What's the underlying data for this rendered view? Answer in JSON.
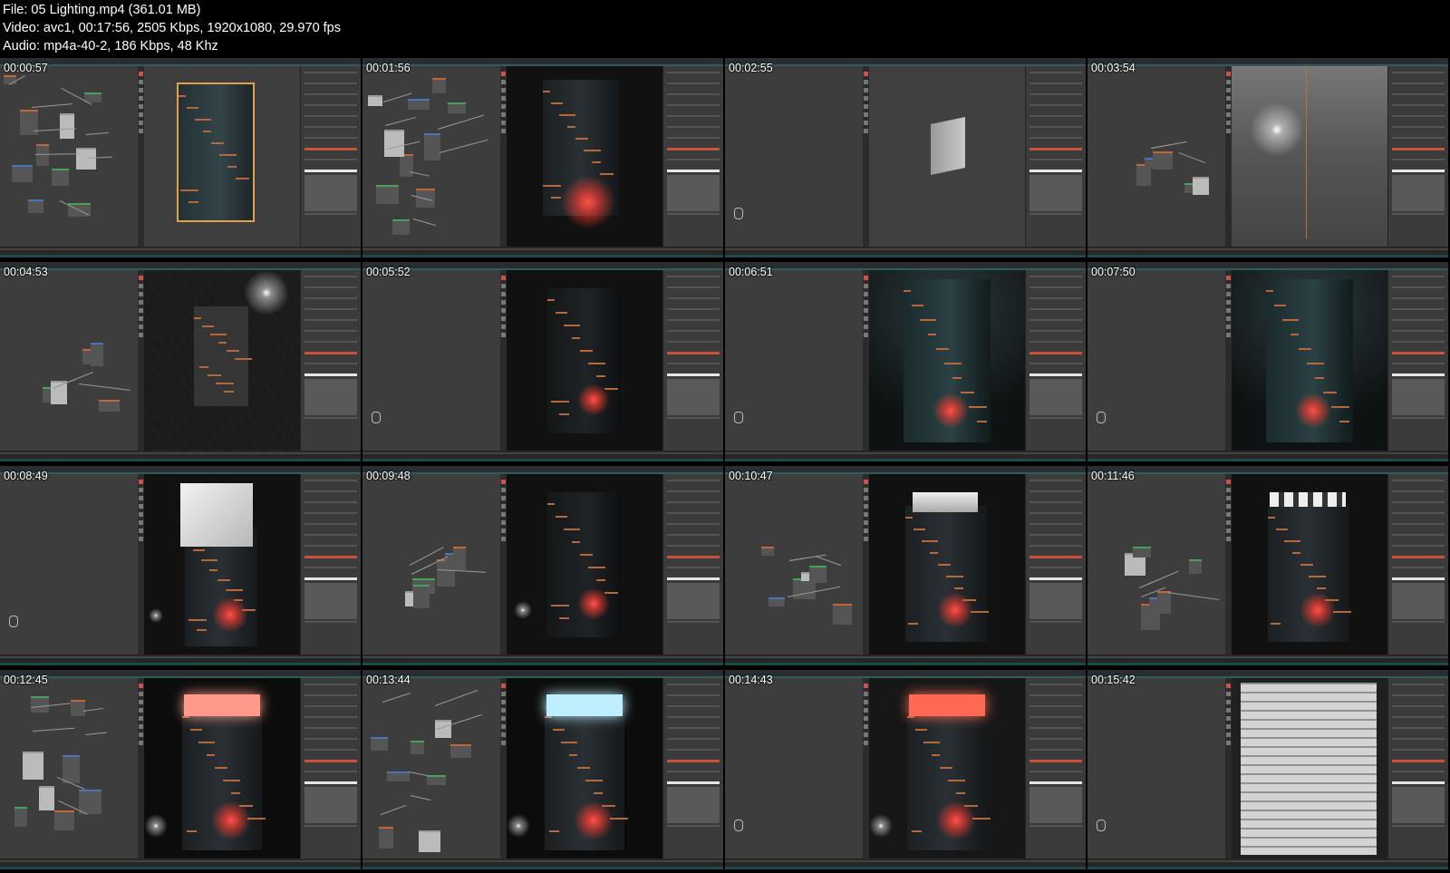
{
  "header": {
    "file_line": "File: 05  Lighting.mp4 (361.01 MB)",
    "video_line": "Video: avc1, 00:17:56, 2505 Kbps, 1920x1080, 29.970 fps",
    "audio_line": "Audio: mp4a-40-2, 186 Kbps, 48 Khz"
  },
  "thumbnails": [
    {
      "timestamp": "00:00:57",
      "scene": "tower-orange-outline"
    },
    {
      "timestamp": "00:01:56",
      "scene": "tower-red-lit"
    },
    {
      "timestamp": "00:02:55",
      "scene": "grey-cube"
    },
    {
      "timestamp": "00:03:54",
      "scene": "light-probe"
    },
    {
      "timestamp": "00:04:53",
      "scene": "grid-tower"
    },
    {
      "timestamp": "00:05:52",
      "scene": "tower-dark"
    },
    {
      "timestamp": "00:06:51",
      "scene": "tower-teal"
    },
    {
      "timestamp": "00:07:50",
      "scene": "tower-teal"
    },
    {
      "timestamp": "00:08:49",
      "scene": "tower-white-cap"
    },
    {
      "timestamp": "00:09:48",
      "scene": "tower-dark-nodes"
    },
    {
      "timestamp": "00:10:47",
      "scene": "tower-white-slab"
    },
    {
      "timestamp": "00:11:46",
      "scene": "tower-white-details"
    },
    {
      "timestamp": "00:12:45",
      "scene": "tower-neon-top"
    },
    {
      "timestamp": "00:13:44",
      "scene": "tower-cyan-top"
    },
    {
      "timestamp": "00:14:43",
      "scene": "tower-red-top"
    },
    {
      "timestamp": "00:15:42",
      "scene": "white-city-model"
    }
  ],
  "colors": {
    "background": "#000000",
    "ui_panel": "#3a3a3a",
    "accent_red": "#c9523f",
    "accent_teal": "#2f5c5f",
    "glow_red": "#ff5048"
  }
}
